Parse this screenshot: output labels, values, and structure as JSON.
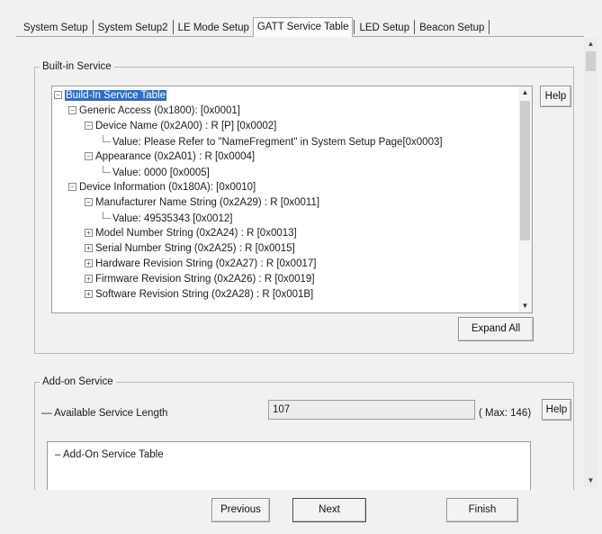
{
  "tabs": [
    {
      "label": "System Setup"
    },
    {
      "label": "System Setup2"
    },
    {
      "label": "LE Mode Setup"
    },
    {
      "label": "GATT Service Table"
    },
    {
      "label": "LED Setup"
    },
    {
      "label": "Beacon Setup"
    }
  ],
  "active_tab": "GATT Service Table",
  "builtin": {
    "title": "Built-in Service",
    "help_label": "Help",
    "expand_all_label": "Expand All",
    "tree": [
      {
        "text": "Build-In Service Table"
      },
      {
        "text": "Generic Access (0x1800):  [0x0001]"
      },
      {
        "text": "Device Name (0x2A00) : R [P] [0x0002]"
      },
      {
        "text": "Value: Please Refer to \"NameFregment\" in System Setup Page[0x0003]"
      },
      {
        "text": "Appearance (0x2A01) : R  [0x0004]"
      },
      {
        "text": "Value: 0000 [0x0005]"
      },
      {
        "text": "Device Information (0x180A):  [0x0010]"
      },
      {
        "text": "Manufacturer Name String (0x2A29) : R  [0x0011]"
      },
      {
        "text": "Value: 49535343 [0x0012]"
      },
      {
        "text": "Model Number String (0x2A24) : R  [0x0013]"
      },
      {
        "text": "Serial Number String (0x2A25) : R  [0x0015]"
      },
      {
        "text": "Hardware Revision String (0x2A27) : R  [0x0017]"
      },
      {
        "text": "Firmware Revision String (0x2A26) : R  [0x0019]"
      },
      {
        "text": "Software Revision String (0x2A28) : R  [0x001B]"
      }
    ]
  },
  "addon": {
    "title": "Add-on Service",
    "length_label": "Available Service Length",
    "length_value": "107",
    "max_label": "( Max: 146)",
    "help_label": "Help",
    "table_root": "Add-On Service Table"
  },
  "footer": {
    "previous_label": "Previous",
    "next_label": "Next",
    "finish_label": "Finish"
  },
  "colors": {
    "selection": "#2f6fc1",
    "background": "#f1f1ef"
  }
}
